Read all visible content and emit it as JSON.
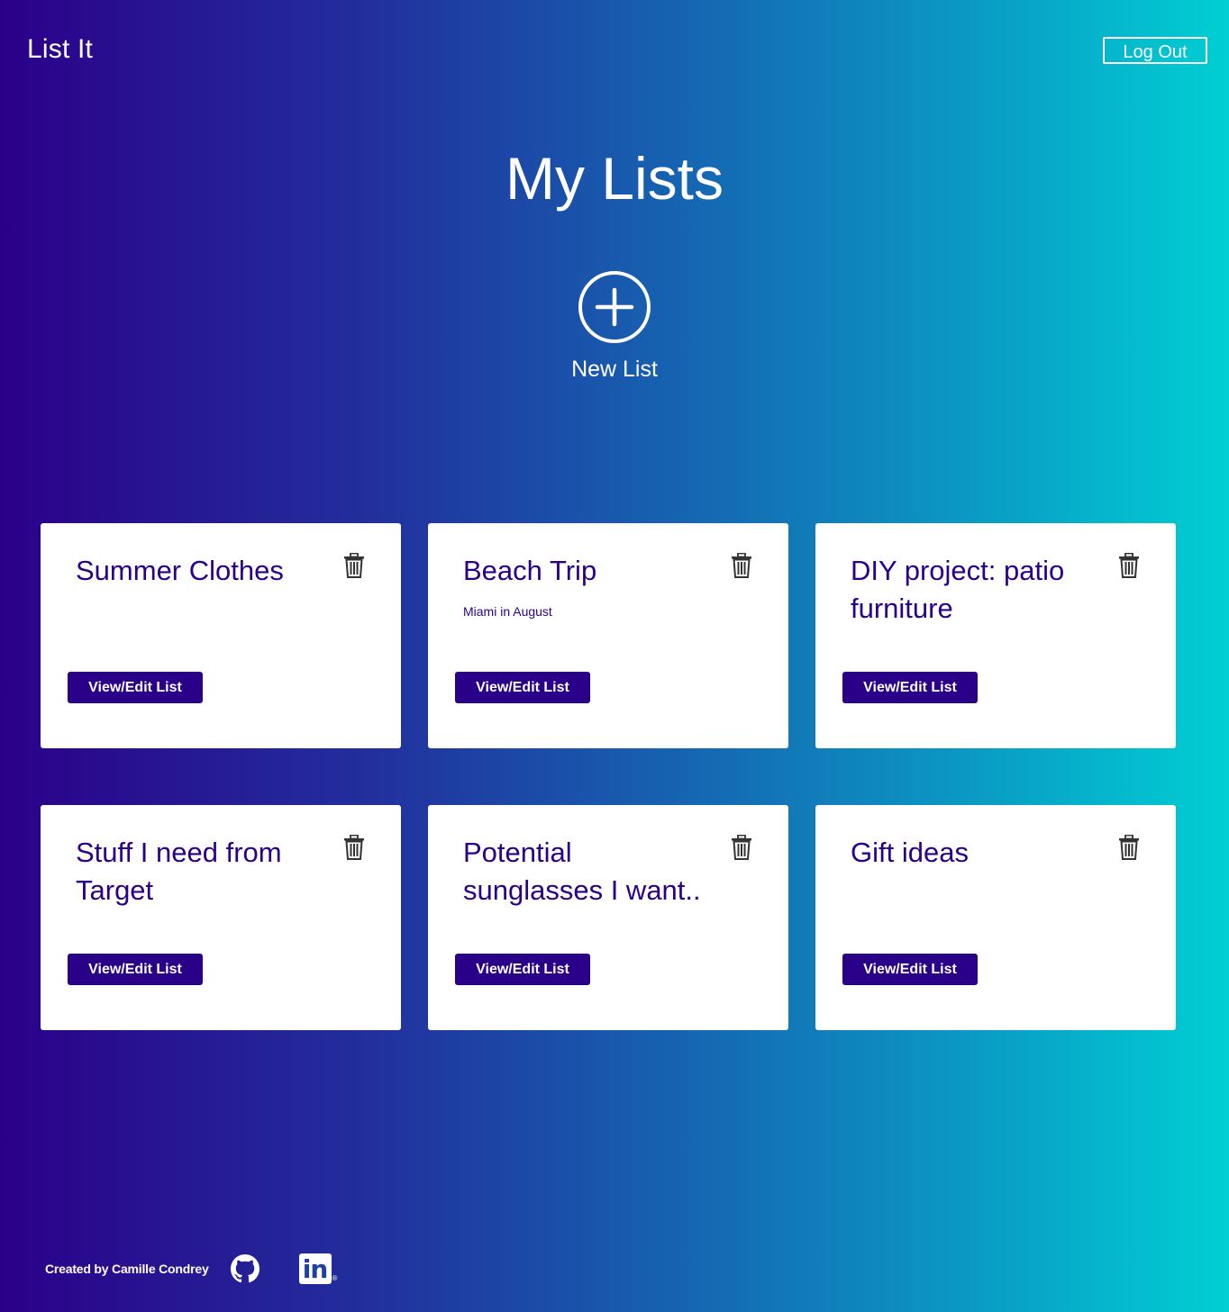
{
  "header": {
    "brand": "List It",
    "logout_label": "Log Out"
  },
  "main": {
    "title": "My Lists",
    "new_list_label": "New List",
    "new_list_icon": "plus-circle-icon",
    "view_button_label": "View/Edit List",
    "delete_icon": "trash-icon",
    "lists": [
      {
        "title": "Summer Clothes",
        "description": ""
      },
      {
        "title": "Beach Trip",
        "description": "Miami in August"
      },
      {
        "title": "DIY project: patio furniture",
        "description": ""
      },
      {
        "title": "Stuff I need from Target",
        "description": ""
      },
      {
        "title": "Potential sunglasses I want..",
        "description": ""
      },
      {
        "title": "Gift ideas",
        "description": ""
      }
    ]
  },
  "footer": {
    "credit": "Created by Camille Condrey",
    "github_icon": "github-icon",
    "linkedin_icon": "linkedin-icon",
    "linkedin_text": "in",
    "linkedin_mark": "®"
  },
  "colors": {
    "gradient_start": "#2b0089",
    "gradient_end": "#00cfd3",
    "accent": "#2b0089",
    "card_background": "#ffffff"
  }
}
